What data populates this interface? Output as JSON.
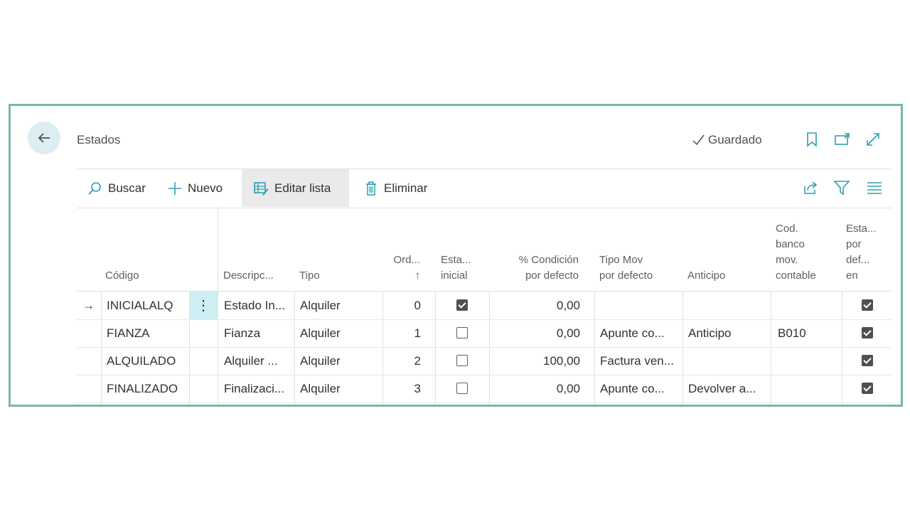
{
  "header": {
    "title": "Estados",
    "saved_label": "Guardado",
    "icons": [
      "back-arrow-icon",
      "check-icon",
      "bookmark-icon",
      "open-new-window-icon",
      "expand-icon"
    ]
  },
  "toolbar": {
    "search_label": "Buscar",
    "new_label": "Nuevo",
    "edit_list_label": "Editar lista",
    "delete_label": "Eliminar",
    "icons": [
      "search-icon",
      "plus-icon",
      "edit-list-icon",
      "trash-icon",
      "share-icon",
      "filter-icon",
      "list-view-icon"
    ]
  },
  "table": {
    "columns": {
      "codigo": "Código",
      "descripcion": "Descripc...",
      "tipo": "Tipo",
      "orden": "Ord...",
      "orden_sort": "↑",
      "estado_inicial_1": "Esta...",
      "estado_inicial_2": "inicial",
      "condicion_1": "% Condición",
      "condicion_2": "por defecto",
      "tipo_mov_1": "Tipo Mov",
      "tipo_mov_2": "por defecto",
      "anticipo": "Anticipo",
      "cod_banco_1": "Cod.",
      "cod_banco_2": "banco",
      "cod_banco_3": "mov.",
      "cod_banco_4": "contable",
      "estado_def_1": "Esta...",
      "estado_def_2": "por",
      "estado_def_3": "def...",
      "estado_def_4": "en"
    },
    "rows": [
      {
        "codigo": "INICIALALQ",
        "descripcion": "Estado In...",
        "tipo": "Alquiler",
        "orden": "0",
        "inicial": true,
        "condicion": "0,00",
        "tipo_mov": "",
        "anticipo": "",
        "cod_banco": "",
        "por_defecto": true
      },
      {
        "codigo": "FIANZA",
        "descripcion": "Fianza",
        "tipo": "Alquiler",
        "orden": "1",
        "inicial": false,
        "condicion": "0,00",
        "tipo_mov": "Apunte co...",
        "anticipo": "Anticipo",
        "cod_banco": "B010",
        "por_defecto": true
      },
      {
        "codigo": "ALQUILADO",
        "descripcion": "Alquiler ...",
        "tipo": "Alquiler",
        "orden": "2",
        "inicial": false,
        "condicion": "100,00",
        "tipo_mov": "Factura ven...",
        "anticipo": "",
        "cod_banco": "",
        "por_defecto": true
      },
      {
        "codigo": "FINALIZADO",
        "descripcion": "Finalizaci...",
        "tipo": "Alquiler",
        "orden": "3",
        "inicial": false,
        "condicion": "0,00",
        "tipo_mov": "Apunte co...",
        "anticipo": "Devolver a...",
        "cod_banco": "",
        "por_defecto": true
      }
    ],
    "selected_row_marker": "→",
    "row_menu": "⋮"
  },
  "colors": {
    "frame_border": "#7ab8a2",
    "accent": "#2e9fb0",
    "back_button_bg": "#dceef2",
    "selected_cell_bg": "#cdeef2"
  }
}
